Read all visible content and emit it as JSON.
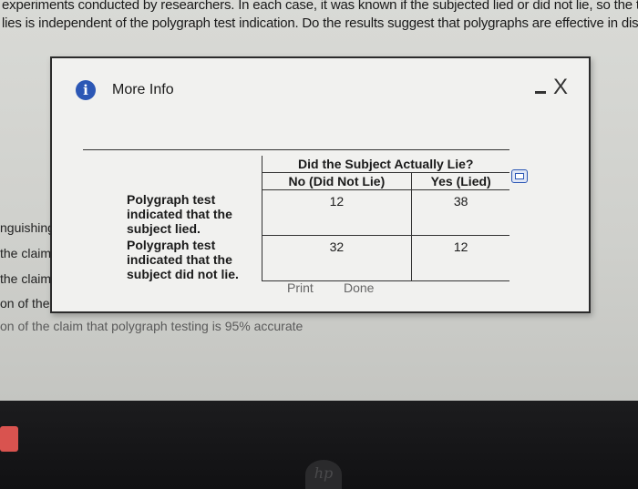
{
  "background": {
    "line1": "experiments conducted by researchers. In each case, it was known if the subjected lied or did not lie, so the t",
    "line2": "lies is independent of the polygraph test indication. Do the results suggest that polygraphs are effective in dis",
    "side1": "nguishing",
    "side2": "the claim th",
    "side3": "the claim th",
    "side4": "on of the clai",
    "side5": "on of the claim that polygraph testing is 95% accurate"
  },
  "dialog": {
    "title": "More Info",
    "info_icon": "i",
    "close_icon": "X",
    "print_label": "Print",
    "done_label": "Done"
  },
  "table": {
    "group_header": "Did the Subject Actually Lie?",
    "col_no": "No (Did Not Lie)",
    "col_yes": "Yes (Lied)",
    "rows": [
      {
        "label": "Polygraph test indicated that the subject lied.",
        "no": "12",
        "yes": "38"
      },
      {
        "label": "Polygraph test indicated that the subject did not lie.",
        "no": "32",
        "yes": "12"
      }
    ]
  },
  "colors": {
    "info": "#2c57b5",
    "border": "#2b2b2b"
  }
}
